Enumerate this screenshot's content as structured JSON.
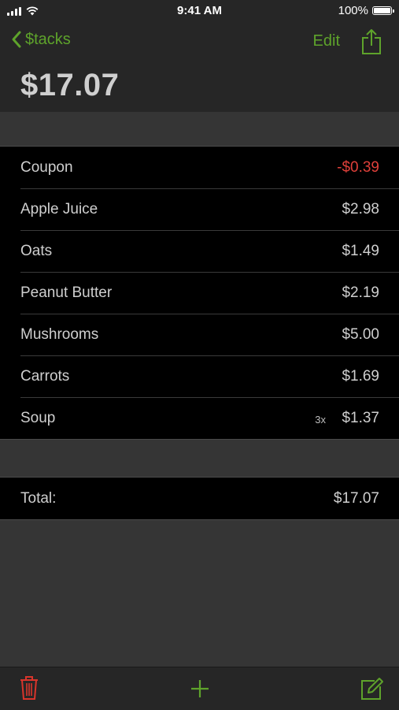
{
  "status": {
    "time": "9:41 AM",
    "battery": "100%"
  },
  "nav": {
    "back_label": "$tacks",
    "edit_label": "Edit",
    "total": "$17.07"
  },
  "items": [
    {
      "name": "Coupon",
      "price": "-$0.39",
      "qty": ""
    },
    {
      "name": "Apple Juice",
      "price": "$2.98",
      "qty": ""
    },
    {
      "name": "Oats",
      "price": "$1.49",
      "qty": ""
    },
    {
      "name": "Peanut Butter",
      "price": "$2.19",
      "qty": ""
    },
    {
      "name": "Mushrooms",
      "price": "$5.00",
      "qty": ""
    },
    {
      "name": "Carrots",
      "price": "$1.69",
      "qty": ""
    },
    {
      "name": "Soup",
      "price": "$1.37",
      "qty": "3x"
    }
  ],
  "total": {
    "label": "Total:",
    "value": "$17.07"
  },
  "toolbar": {
    "icons": [
      "trash-icon",
      "plus-icon",
      "compose-icon"
    ]
  },
  "colors": {
    "accent": "#5ea32b",
    "negative": "#e0403a",
    "delete": "#d9352b",
    "list_bg": "#000000",
    "bar_bg": "#262626",
    "body_bg": "#353535"
  }
}
